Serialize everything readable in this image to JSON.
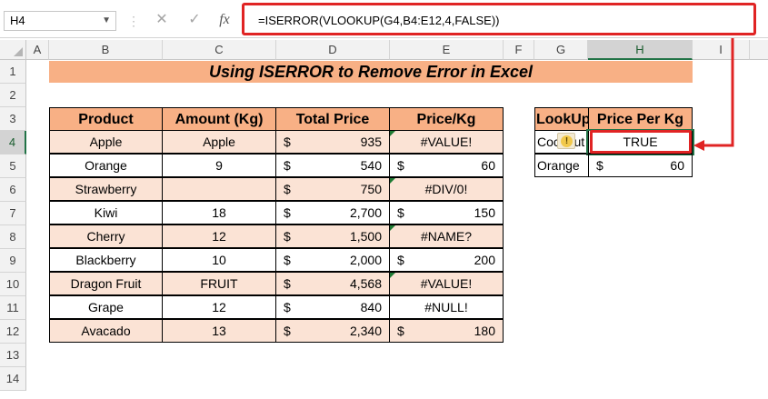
{
  "namebox": "H4",
  "formula_bar": {
    "cancel_icon": "✕",
    "enter_icon": "✓",
    "fx_label": "fx",
    "formula": "=ISERROR(VLOOKUP(G4,B4:E12,4,FALSE))"
  },
  "columns": [
    "A",
    "B",
    "C",
    "D",
    "E",
    "F",
    "G",
    "H",
    "I"
  ],
  "rows": [
    "1",
    "2",
    "3",
    "4",
    "5",
    "6",
    "7",
    "8",
    "9",
    "10",
    "11",
    "12",
    "13",
    "14"
  ],
  "title": "Using ISERROR to Remove Error in Excel",
  "table": {
    "headers": [
      "Product",
      "Amount (Kg)",
      "Total Price",
      "Price/Kg"
    ],
    "rows": [
      {
        "product": "Apple",
        "amount": "Apple",
        "tp_cur": "$",
        "tp": "935",
        "pk_cur": "",
        "pk": "#VALUE!"
      },
      {
        "product": "Orange",
        "amount": "9",
        "tp_cur": "$",
        "tp": "540",
        "pk_cur": "$",
        "pk": "60"
      },
      {
        "product": "Strawberry",
        "amount": "",
        "tp_cur": "$",
        "tp": "750",
        "pk_cur": "",
        "pk": "#DIV/0!"
      },
      {
        "product": "Kiwi",
        "amount": "18",
        "tp_cur": "$",
        "tp": "2,700",
        "pk_cur": "$",
        "pk": "150"
      },
      {
        "product": "Cherry",
        "amount": "12",
        "tp_cur": "$",
        "tp": "1,500",
        "pk_cur": "",
        "pk": "#NAME?"
      },
      {
        "product": "Blackberry",
        "amount": "10",
        "tp_cur": "$",
        "tp": "2,000",
        "pk_cur": "$",
        "pk": "200"
      },
      {
        "product": "Dragon Fruit",
        "amount": "FRUIT",
        "tp_cur": "$",
        "tp": "4,568",
        "pk_cur": "",
        "pk": "#VALUE!"
      },
      {
        "product": "Grape",
        "amount": "12",
        "tp_cur": "$",
        "tp": "840",
        "pk_cur": "",
        "pk": "#NULL!"
      },
      {
        "product": "Avacado",
        "amount": "13",
        "tp_cur": "$",
        "tp": "2,340",
        "pk_cur": "$",
        "pk": "180"
      }
    ]
  },
  "lookup": {
    "headers": [
      "LookUp",
      "Price Per Kg"
    ],
    "rows": [
      {
        "lookup": "Coconut",
        "value_cur": "",
        "value": "TRUE"
      },
      {
        "lookup": "Orange",
        "value_cur": "$",
        "value": "60"
      }
    ],
    "warning_icon": "!"
  },
  "colors": {
    "accent_red": "#e02424",
    "header_fill": "#f8b085",
    "band_fill": "#fbe3d5",
    "excel_green": "#217346"
  }
}
